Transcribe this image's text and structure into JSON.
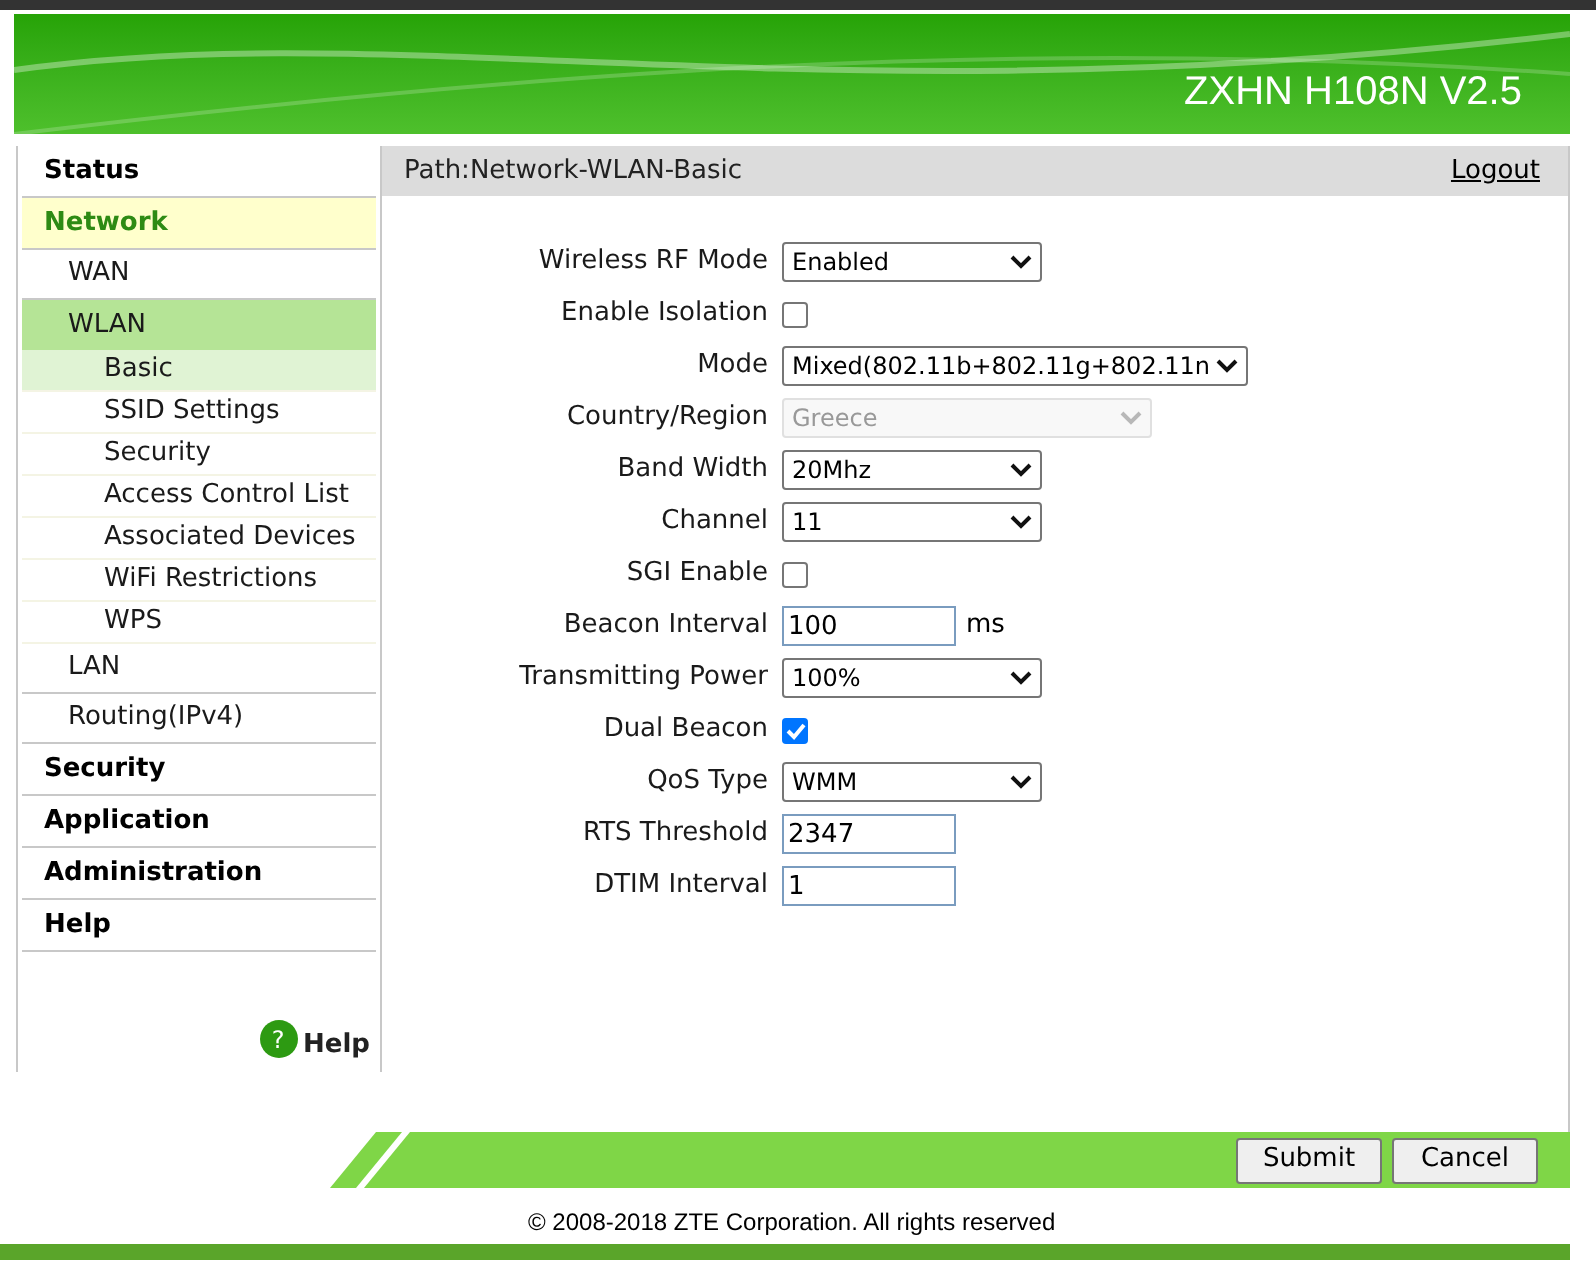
{
  "header": {
    "title": "ZXHN H108N V2.5"
  },
  "menu": [
    {
      "label": "Status",
      "selected": false
    },
    {
      "label": "Network",
      "selected": true,
      "children": [
        {
          "label": "WAN",
          "selected": false
        },
        {
          "label": "WLAN",
          "selected": true,
          "children": [
            {
              "label": "Basic",
              "selected": true
            },
            {
              "label": "SSID Settings",
              "selected": false
            },
            {
              "label": "Security",
              "selected": false
            },
            {
              "label": "Access Control List",
              "selected": false
            },
            {
              "label": "Associated Devices",
              "selected": false
            },
            {
              "label": "WiFi Restrictions",
              "selected": false
            },
            {
              "label": "WPS",
              "selected": false
            }
          ]
        },
        {
          "label": "LAN",
          "selected": false
        },
        {
          "label": "Routing(IPv4)",
          "selected": false
        }
      ]
    },
    {
      "label": "Security",
      "selected": false
    },
    {
      "label": "Application",
      "selected": false
    },
    {
      "label": "Administration",
      "selected": false
    },
    {
      "label": "Help",
      "selected": false
    }
  ],
  "help_link": {
    "icon": "?",
    "label": "Help"
  },
  "path": "Path:Network-WLAN-Basic",
  "logout": "Logout",
  "fields": [
    {
      "kind": "select",
      "label": "Wireless RF Mode",
      "value": "Enabled",
      "disabled": false
    },
    {
      "kind": "checkbox",
      "label": "Enable Isolation",
      "checked": false
    },
    {
      "kind": "select",
      "label": "Mode",
      "value": "Mixed(802.11b+802.11g+802.11n",
      "disabled": false
    },
    {
      "kind": "select",
      "label": "Country/Region",
      "value": "Greece",
      "disabled": true
    },
    {
      "kind": "select",
      "label": "Band Width",
      "value": "20Mhz",
      "disabled": false
    },
    {
      "kind": "select",
      "label": "Channel",
      "value": "11",
      "disabled": false
    },
    {
      "kind": "checkbox",
      "label": "SGI Enable",
      "checked": false
    },
    {
      "kind": "text",
      "label": "Beacon Interval",
      "value": "100",
      "unit": "ms"
    },
    {
      "kind": "select",
      "label": "Transmitting Power",
      "value": "100%",
      "disabled": false
    },
    {
      "kind": "checkbox",
      "label": "Dual Beacon",
      "checked": true
    },
    {
      "kind": "select",
      "label": "QoS Type",
      "value": "WMM",
      "disabled": false
    },
    {
      "kind": "text",
      "label": "RTS Threshold",
      "value": "2347"
    },
    {
      "kind": "text",
      "label": "DTIM Interval",
      "value": "1"
    }
  ],
  "buttons": [
    "Submit",
    "Cancel"
  ],
  "footer": "© 2008-2018 ZTE Corporation. All rights reserved"
}
